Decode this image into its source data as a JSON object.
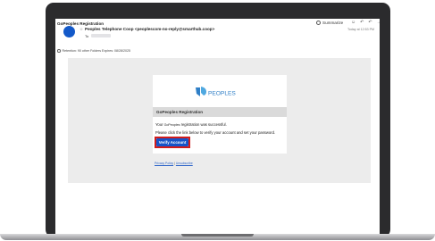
{
  "email": {
    "subject": "GoPeoples Registration",
    "summarize_label": "Summarize",
    "actions": [
      "☺",
      "↶",
      "↶",
      "→"
    ],
    "date": "Today at 12:53 PM",
    "sender": "Peoples Telephone Coop <peoplescom-no-reply@smarthub.coop>",
    "to_label": "To",
    "retention": "Retention: 90 other Folders Expires: 08/28/2025",
    "star": "☆"
  },
  "message": {
    "logo_text": "PEOPLES",
    "heading": "GoPeoples Registration",
    "line1_prefix": "Your ",
    "line1_brand": "GoPeoples",
    "line1_suffix": " registration was successful.",
    "line2": "Please click the link below to verify your account and set your password.",
    "verify_button": "Verify Account",
    "privacy": "Privacy Policy",
    "sep": " | ",
    "unsubscribe": "Unsubscribe"
  },
  "colors": {
    "brand_blue": "#1553c9",
    "highlight_red": "#d01b1b",
    "avatar_blue": "#1359c9"
  }
}
